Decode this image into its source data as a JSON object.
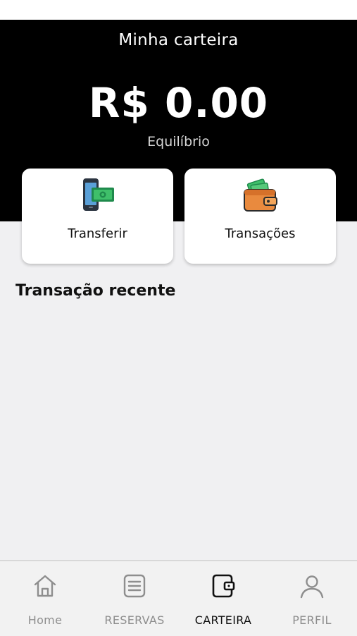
{
  "header": {
    "title": "Minha carteira",
    "balance": "R$ 0.00",
    "balance_label": "Equilíbrio"
  },
  "actions": [
    {
      "label": "Transferir",
      "icon": "phone-money-transfer-icon"
    },
    {
      "label": "Transações",
      "icon": "wallet-money-icon"
    }
  ],
  "recent": {
    "title": "Transação recente"
  },
  "nav": {
    "items": [
      {
        "label": "Home",
        "icon": "home-icon",
        "active": false
      },
      {
        "label": "RESERVAS",
        "icon": "list-document-icon",
        "active": false
      },
      {
        "label": "CARTEIRA",
        "icon": "wallet-icon",
        "active": true
      },
      {
        "label": "PERFIL",
        "icon": "user-icon",
        "active": false
      }
    ]
  },
  "colors": {
    "header_bg": "#000000",
    "page_bg": "#f0f0f2",
    "nav_active": "#111111",
    "nav_inactive": "#8e8e8e"
  }
}
